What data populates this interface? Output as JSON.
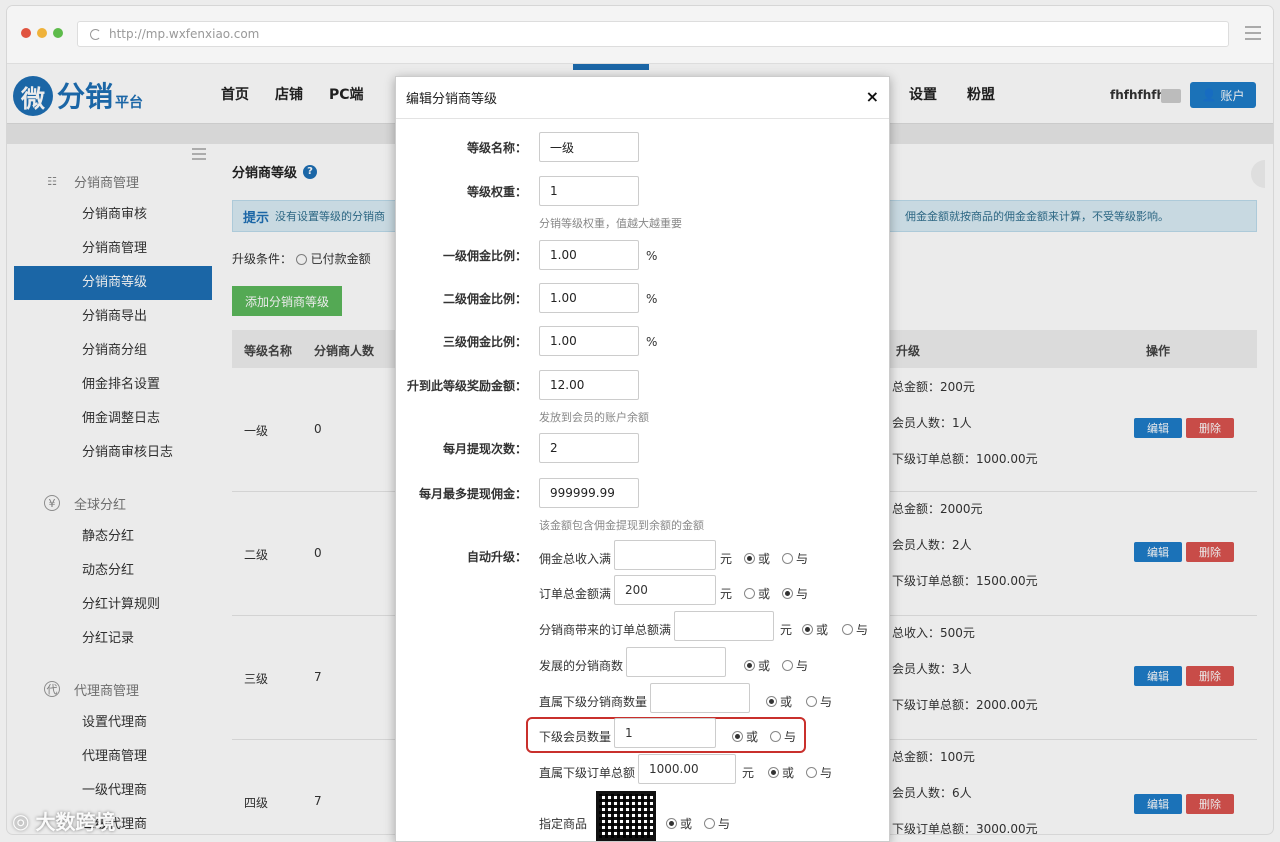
{
  "browser": {
    "url": "http://mp.wxfenxiao.com"
  },
  "logo": {
    "mark": "微",
    "text": "分销",
    "sub": "平台"
  },
  "nav": {
    "items": [
      "首页",
      "店铺",
      "PC端"
    ],
    "right_items": [
      "设置",
      "粉盟"
    ]
  },
  "user": {
    "name": "fhfhfhfh",
    "account_label": "账户"
  },
  "sidebar": {
    "group1": {
      "label": "分销商管理",
      "items": [
        "分销商审核",
        "分销商管理",
        "分销商等级",
        "分销商导出",
        "分销商分组",
        "佣金排名设置",
        "佣金调整日志",
        "分销商审核日志"
      ]
    },
    "group2": {
      "label": "全球分红",
      "items": [
        "静态分红",
        "动态分红",
        "分红计算规则",
        "分红记录"
      ]
    },
    "group3": {
      "label": "代理商管理",
      "items": [
        "设置代理商",
        "代理商管理",
        "一级代理商",
        "二级代理商"
      ]
    }
  },
  "main": {
    "title": "分销商等级",
    "tip_label": "提示",
    "tip_text": "没有设置等级的分销商",
    "tip_text_right": "佣金金额就按商品的佣金金额来计算，不受等级影响。",
    "upgrade_condition": "升级条件：",
    "upgrade_value": "已付款金额",
    "add_button": "添加分销商等级",
    "columns": {
      "name": "等级名称",
      "count": "分销商人数",
      "upgrade": "升级",
      "actions": "操作"
    },
    "rows": [
      {
        "name": "一级",
        "count": "0",
        "c1": "总金额：200元",
        "c2": "会员人数：1人",
        "c3": "下级订单总额：1000.00元"
      },
      {
        "name": "二级",
        "count": "0",
        "c1": "总金额：2000元",
        "c2": "会员人数：2人",
        "c3": "下级订单总额：1500.00元"
      },
      {
        "name": "三级",
        "count": "7",
        "c1": "总收入：500元",
        "c2": "会员人数：3人",
        "c3": "下级订单总额：2000.00元"
      },
      {
        "name": "四级",
        "count": "7",
        "c1": "总金额：100元",
        "c2": "会员人数：6人",
        "c3": "下级订单总额：3000.00元"
      }
    ],
    "edit_label": "编辑",
    "delete_label": "删除"
  },
  "modal": {
    "title": "编辑分销商等级",
    "close": "×",
    "fields": {
      "level_name": {
        "label": "等级名称：",
        "value": "一级"
      },
      "level_weight": {
        "label": "等级权重：",
        "value": "1",
        "hint": "分销等级权重，值越大越重要"
      },
      "commission1": {
        "label": "一级佣金比例：",
        "value": "1.00",
        "unit": "%"
      },
      "commission2": {
        "label": "二级佣金比例：",
        "value": "1.00",
        "unit": "%"
      },
      "commission3": {
        "label": "三级佣金比例：",
        "value": "1.00",
        "unit": "%"
      },
      "reward": {
        "label": "升到此等级奖励金额：",
        "value": "12.00",
        "hint": "发放到会员的账户余额"
      },
      "monthly_count": {
        "label": "每月提现次数：",
        "value": "2"
      },
      "monthly_max": {
        "label": "每月最多提现佣金：",
        "value": "999999.99",
        "hint": "该金额包含佣金提现到余额的金额"
      }
    },
    "auto_upgrade": {
      "label": "自动升级：",
      "or": "或",
      "and": "与",
      "unit": "元",
      "conditions": [
        {
          "label": "佣金总收入满",
          "value": "",
          "unit": "元",
          "selected": "or"
        },
        {
          "label": "订单总金额满",
          "value": "200",
          "unit": "元",
          "selected": "and"
        },
        {
          "label": "分销商带来的订单总额满",
          "value": "",
          "unit": "元",
          "selected": "or"
        },
        {
          "label": "发展的分销商数",
          "value": "",
          "unit": "",
          "selected": "or"
        },
        {
          "label": "直属下级分销商数量",
          "value": "",
          "unit": "",
          "selected": "or"
        },
        {
          "label": "下级会员数量",
          "value": "1",
          "unit": "",
          "selected": "or"
        },
        {
          "label": "直属下级订单总额",
          "value": "1000.00",
          "unit": "元",
          "selected": "or"
        },
        {
          "label": "指定商品",
          "value": "",
          "unit": "",
          "selected": "or"
        }
      ]
    }
  },
  "watermark": {
    "text": "大数跨境"
  },
  "colors": {
    "brand": "#1e6fb5",
    "success": "#5cb85c",
    "danger": "#d9534f",
    "highlight": "#c9302c"
  }
}
